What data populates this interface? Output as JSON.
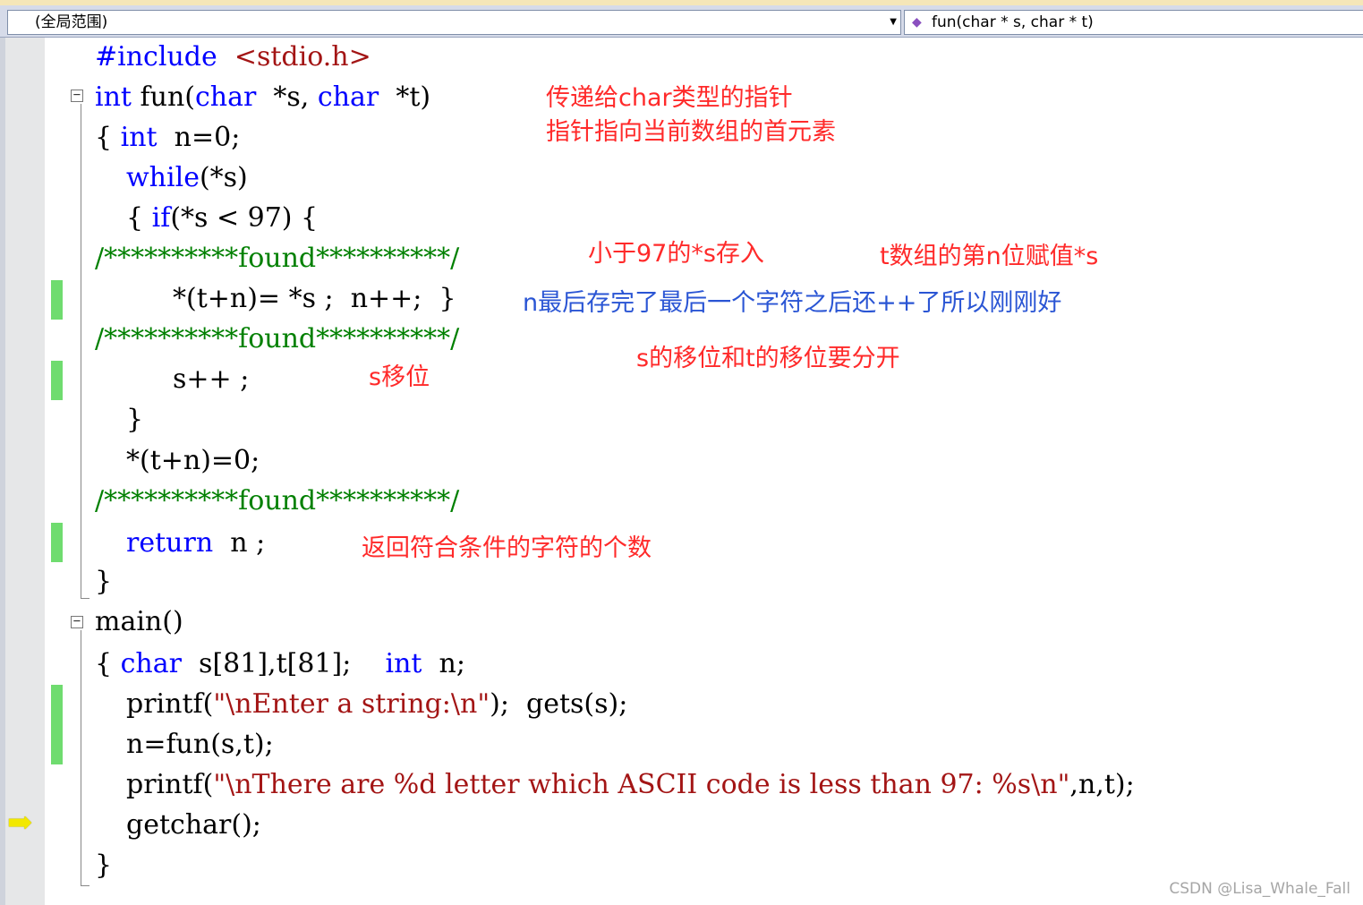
{
  "nav": {
    "scope_label": "(全局范围)",
    "member_label": "fun(char * s, char * t)"
  },
  "code": {
    "l01_directive": "#include",
    "l01_header": "<stdio.h>",
    "l02_int": "int",
    "l02_rest1": " fun(",
    "l02_char1": "char",
    "l02_rest2": "  *s, ",
    "l02_char2": "char",
    "l02_rest3": "  *t)",
    "l03_brace": "{ ",
    "l03_int": "int",
    "l03_rest": "  n=0;",
    "l04_while": "while",
    "l04_rest": "(*s)",
    "l05_brace": "{ ",
    "l05_if": "if",
    "l05_rest": "(*s < 97) {",
    "l06_comment": "/**********found**********/",
    "l07": "*(t+n)= *s ;  n++;  }",
    "l08_comment": "/**********found**********/",
    "l09": "s++ ;",
    "l10": "}",
    "l11": "*(t+n)=0;",
    "l12_comment": "/**********found**********/",
    "l13_return": "return",
    "l13_rest": "  n ;",
    "l14": "}",
    "l15": "main()",
    "l16_brace": "{ ",
    "l16_char": "char",
    "l16_mid": "  s[81],t[81];    ",
    "l16_int": "int",
    "l16_rest": "  n;",
    "l17_a": "printf(",
    "l17_str": "\"\\nEnter a string:\\n\"",
    "l17_b": ");  gets(s);",
    "l18": "n=fun(s,t);",
    "l19_a": "printf(",
    "l19_str": "\"\\nThere are %d letter which ASCII code is less than 97: %s\\n\"",
    "l19_b": ",n,t);",
    "l20": "getchar();",
    "l21": "}"
  },
  "annotations": {
    "a1": "传递给char类型的指针",
    "a2": "指针指向当前数组的首元素",
    "a3": "小于97的*s存入",
    "a4": "t数组的第n位赋值*s",
    "a5": "n最后存完了最后一个字符之后还++了所以刚刚好",
    "a6": "s的移位和t的移位要分开",
    "a7": "s移位",
    "a8": "返回符合条件的字符的个数"
  },
  "watermark": "CSDN @Lisa_Whale_Fall"
}
